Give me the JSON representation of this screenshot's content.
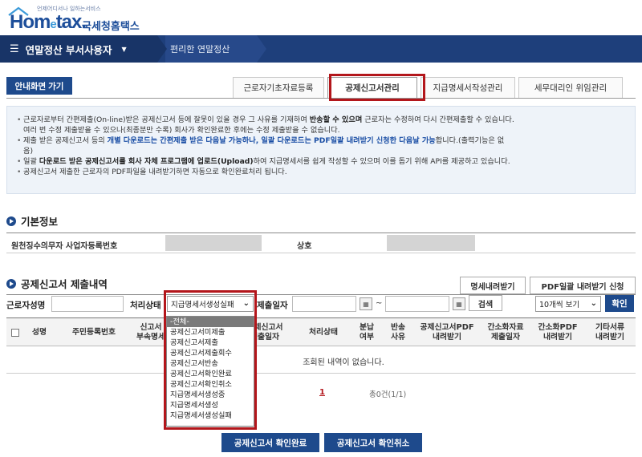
{
  "header": {
    "logo_small": "언제어디서나 일하는서비스",
    "logo_home": "Hom",
    "logo_e": "e",
    "logo_tax": "tax.",
    "logo_kr": "국세청홈택스"
  },
  "nav": {
    "menu_title": "연말정산 부서사용자",
    "sub_title": "편리한 연말정산"
  },
  "guide_button": "안내화면 가기",
  "tabs": [
    {
      "label": "근로자기초자료등록"
    },
    {
      "label": "공제신고서관리"
    },
    {
      "label": "지급명세서작성관리"
    },
    {
      "label": "세무대리인 위임관리"
    }
  ],
  "notice": {
    "l1a": "근로자로부터 간편제출(On-line)받은 공제신고서 등에 잘못이 있을 경우 그 사유를 기재하여 ",
    "l1b": "반송할 수 있으며",
    "l1c": " 근로자는 수정하여 다시 간편제출할 수 있습니다.",
    "l2": "여러 번 수정 제출받을 수 있으나(최종분만 수록) 회사가 확인완료한 후에는 수정 제출받을 수 없습니다.",
    "l3a": "제출 받은 공제신고서 등의 ",
    "l3b": "개별 다운로드는 간편제출 받은 다음날 가능하나, 일괄 다운로드는 PDF일괄 내려받기 신청한 다음날 가능",
    "l3c": "합니다.(출력기능은 없",
    "l4": "음)",
    "l5a": "일괄 ",
    "l5b": "다운로드 받은 공제신고서를 회사 자체 프로그램에 업로드(Upload)",
    "l5c": "하여 지급명세서를 쉽게 작성할 수 있으며 이를 돕기 위해 API를 제공하고 있습니다.",
    "l6": "공제신고서 제출한 근로자의 PDF파일을 내려받기하면 자동으로 확인완료처리 됩니다."
  },
  "basic_info": {
    "title": "기본정보",
    "biz_label": "원천징수의무자 사업자등록번호",
    "name_label": "상호"
  },
  "submissions": {
    "title": "공제신고서 제출내역",
    "detail_download": "명세내려받기",
    "pdf_request": "PDF일괄 내려받기 신청",
    "search": {
      "name_label": "근로자성명",
      "status_label": "처리상태",
      "status_selected": "지급명세서생성실패",
      "date_label": "제출일자",
      "tilde": "~",
      "search_button": "검색",
      "page_size": "10개씩 보기",
      "confirm_button": "확인"
    },
    "columns": [
      "성명",
      "주민등록번호",
      "신고서\n부속명세",
      "공제신고서\n제출일자",
      "처리상태",
      "분납\n여부",
      "반송\n사유",
      "공제신고서PDF\n내려받기",
      "간소화자료\n제출일자",
      "간소화PDF\n내려받기",
      "기타서류\n내려받기"
    ],
    "empty_message": "조회된 내역이 없습니다.",
    "page": "1",
    "count": "총0건(1/1)",
    "confirm_complete": "공제신고서 확인완료",
    "confirm_cancel": "공제신고서 확인취소"
  },
  "status_options": [
    "-전체-",
    "공제신고서미제출",
    "공제신고서제출",
    "공제신고서제출회수",
    "공제신고서반송",
    "공제신고서확인완료",
    "공제신고서확인취소",
    "지급명세서생성중",
    "지급명세서생성",
    "지급명세서생성실패"
  ],
  "colors": {
    "navy": "#1e3f7b",
    "accent_blue": "#1e4a8c",
    "highlight_red": "#b3161b"
  }
}
